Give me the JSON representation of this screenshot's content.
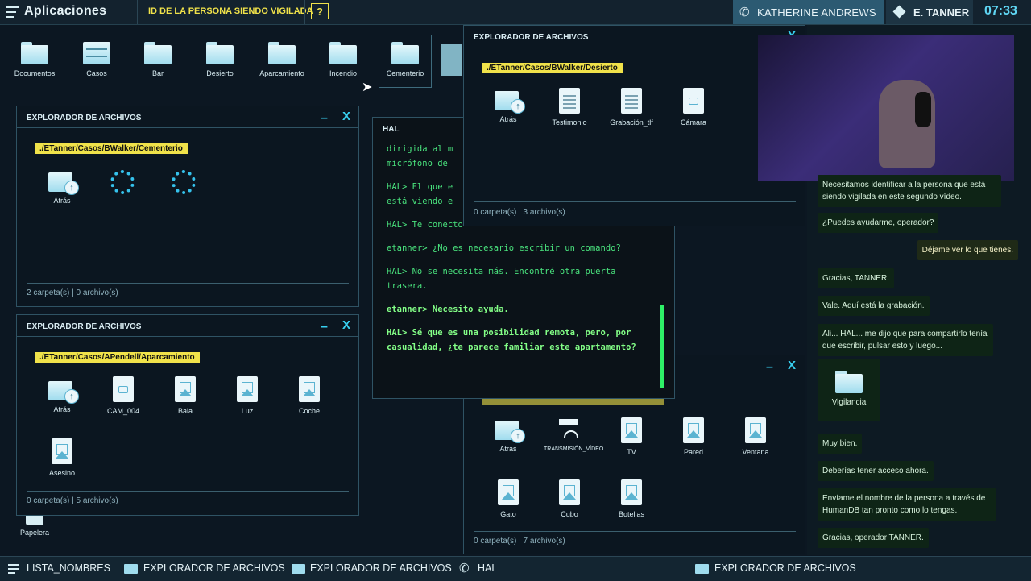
{
  "topbar": {
    "apps_title": "Aplicaciones",
    "target_label": "ID DE LA PERSONA SIENDO VIGILADA",
    "help_label": "?",
    "caller_name": "KATHERINE ANDREWS",
    "user_name": "E. TANNER",
    "clock": "07:33"
  },
  "desktop": {
    "icons": [
      {
        "label": "Documentos",
        "icon": "folder-icon"
      },
      {
        "label": "Casos",
        "icon": "drawer-icon"
      },
      {
        "label": "Bar",
        "icon": "folder-icon"
      },
      {
        "label": "Desierto",
        "icon": "folder-icon"
      },
      {
        "label": "Aparcamiento",
        "icon": "folder-icon"
      },
      {
        "label": "Incendio",
        "icon": "folder-icon"
      },
      {
        "label": "Cementerio",
        "icon": "folder-icon"
      }
    ],
    "trash_label": "Papelera"
  },
  "win_cementerio": {
    "title": "EXPLORADOR DE ARCHIVOS",
    "path": "./ETanner/Casos/BWalker/Cementerio",
    "items": [
      "Atrás"
    ],
    "footer": "2 carpeta(s) | 0 archivo(s)"
  },
  "win_aparcamiento": {
    "title": "EXPLORADOR DE ARCHIVOS",
    "path": "./ETanner/Casos/APendell/Aparcamiento",
    "items": [
      "Atrás",
      "CAM_004",
      "Bala",
      "Luz",
      "Coche",
      "Asesino"
    ],
    "footer": "0 carpeta(s) | 5 archivo(s)"
  },
  "win_desierto": {
    "title": "EXPLORADOR DE ARCHIVOS",
    "path": "./ETanner/Casos/BWalker/Desierto",
    "items": [
      "Atrás",
      "Testimonio",
      "Grabación_tlf",
      "Cámara"
    ],
    "footer": "0 carpeta(s) | 3 archivo(s)"
  },
  "win_vigilancia": {
    "items": [
      "Atrás",
      "TRANSMISIÓN_VÍDEO",
      "TV",
      "Pared",
      "Ventana",
      "Gato",
      "Cubo",
      "Botellas"
    ],
    "footer": "0 carpeta(s) | 7 archivo(s)"
  },
  "hal": {
    "title": "HAL",
    "lines": [
      "dirigida al m",
      "micrófono de",
      "HAL> El que e",
      "está viendo e",
      "HAL> Te conecto",
      "etanner> ¿No es necesario escribir un comando?",
      "HAL> No se necesita más. Encontré otra puerta trasera.",
      "etanner> Necesito ayuda.",
      "HAL> Sé que es una posibilidad remota, pero, por casualidad, ¿te parece familiar este apartamento?"
    ]
  },
  "chat": {
    "messages": [
      {
        "text": "Necesitamos identificar a la persona que está siendo vigilada en este segundo vídeo.",
        "me": false
      },
      {
        "text": "¿Puedes ayudarme, operador?",
        "me": false
      },
      {
        "text": "Déjame ver lo que tienes.",
        "me": true
      },
      {
        "text": "Gracias, TANNER.",
        "me": false
      },
      {
        "text": "Vale. Aquí está la grabación.",
        "me": false
      },
      {
        "text": "Ali... HAL... me dijo que para compartirlo tenía que escribir, pulsar esto y luego...",
        "me": false
      },
      {
        "text": "Vigilancia",
        "me": false,
        "folder": true
      },
      {
        "text": "Muy bien.",
        "me": false
      },
      {
        "text": "Deberías tener acceso ahora.",
        "me": false
      },
      {
        "text": "Envíame el nombre de la persona a través de HumanDB tan pronto como lo tengas.",
        "me": false
      },
      {
        "text": "Gracias, operador TANNER.",
        "me": false
      }
    ]
  },
  "taskbar": {
    "items": [
      "LISTA_NOMBRES",
      "EXPLORADOR DE ARCHIVOS",
      "EXPLORADOR DE ARCHIVOS",
      "HAL",
      "EXPLORADOR DE ARCHIVOS"
    ]
  }
}
